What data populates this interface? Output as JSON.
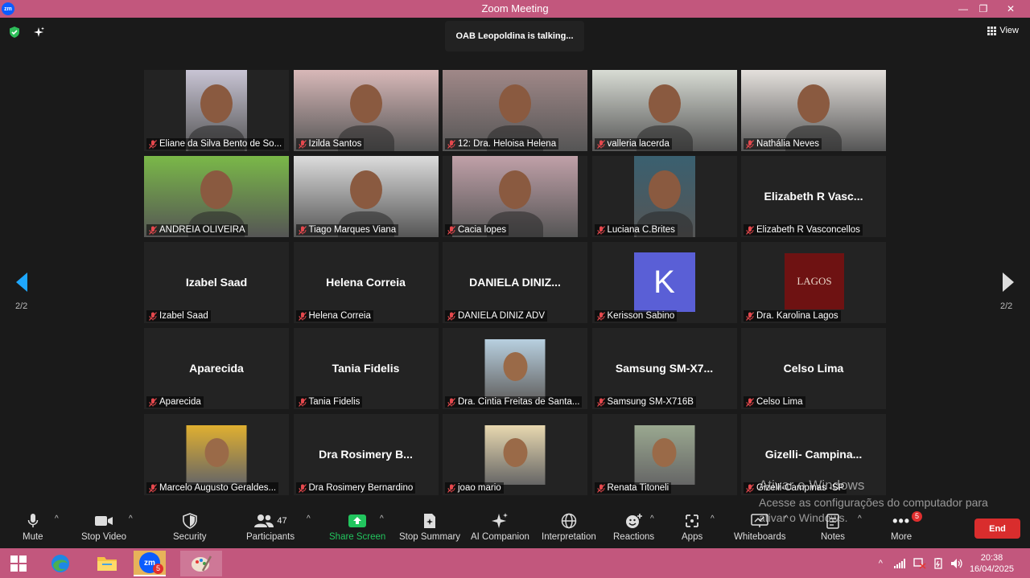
{
  "window": {
    "title": "Zoom Meeting",
    "minimize": "—",
    "maximize": "❐",
    "close": "✕"
  },
  "header": {
    "talking": "OAB Leopoldina is talking...",
    "view_label": "View"
  },
  "pager": {
    "left": "2/2",
    "right": "2/2"
  },
  "tiles": [
    {
      "name": "Eliane da Silva Bento de So...",
      "video": true,
      "bg": "#c8c4d4"
    },
    {
      "name": "Izilda Santos",
      "video": true,
      "bg": "#d8b8b8"
    },
    {
      "name": "12: Dra. Heloisa Helena",
      "video": true,
      "bg": "#a08888"
    },
    {
      "name": "valleria lacerda",
      "video": true,
      "bg": "#d8dcd4"
    },
    {
      "name": "Nathália Neves",
      "video": true,
      "bg": "#e4e0dc"
    },
    {
      "name": "ANDREIA OLIVEIRA",
      "video": true,
      "bg": "#7ab848"
    },
    {
      "name": "Tiago Marques Viana",
      "video": true,
      "bg": "#dcdcdc"
    },
    {
      "name": "Cacia lopes",
      "video": true,
      "bg": "#c0a0a8"
    },
    {
      "name": "Luciana C.Brites",
      "video": true,
      "bg": "#3a6070"
    },
    {
      "name": "Elizabeth R Vasconcellos",
      "big": "Elizabeth R Vasc...",
      "video": false
    },
    {
      "name": "Izabel Saad",
      "big": "Izabel Saad",
      "video": false
    },
    {
      "name": "Helena Correia",
      "big": "Helena Correia",
      "video": false
    },
    {
      "name": "DANIELA DINIZ ADV",
      "big": "DANIELA DINIZ...",
      "video": false
    },
    {
      "name": "Kerisson Sabino",
      "avatar": "K",
      "video": false
    },
    {
      "name": "Dra. Karolina Lagos",
      "logo": "LAGOS",
      "video": false
    },
    {
      "name": "Aparecida",
      "big": "Aparecida",
      "video": false
    },
    {
      "name": "Tania Fidelis",
      "big": "Tania Fidelis",
      "video": false
    },
    {
      "name": "Dra. Cintia Freitas de Santa...",
      "photo": true,
      "bg": "#b8d0e0",
      "video": false
    },
    {
      "name": "Samsung SM-X716B",
      "big": "Samsung SM-X7...",
      "video": false
    },
    {
      "name": "Celso Lima",
      "big": "Celso Lima",
      "video": false
    },
    {
      "name": "Marcelo Augusto Geraldes...",
      "photo": true,
      "bg": "#e0b030",
      "video": false
    },
    {
      "name": "Dra Rosimery Bernardino",
      "big": "Dra Rosimery B...",
      "video": false
    },
    {
      "name": "joao mario",
      "photo": true,
      "bg": "#e8d8b0",
      "video": false
    },
    {
      "name": "Renata Titoneli",
      "photo": true,
      "bg": "#9aa890",
      "video": false
    },
    {
      "name": "Gizelli-Campinas -SP",
      "big": "Gizelli-  Campina...",
      "video": false
    }
  ],
  "toolbar": {
    "mute": "Mute",
    "stop_video": "Stop Video",
    "security": "Security",
    "participants": "Participants",
    "participants_count": "47",
    "share_screen": "Share Screen",
    "stop_summary": "Stop Summary",
    "ai_companion": "AI Companion",
    "interpretation": "Interpretation",
    "reactions": "Reactions",
    "apps": "Apps",
    "whiteboards": "Whiteboards",
    "notes": "Notes",
    "more": "More",
    "more_badge": "5",
    "end": "End"
  },
  "watermark": {
    "title": "Ativar o Windows",
    "body": "Acesse as configurações do computador para ativar o Windows."
  },
  "taskbar": {
    "time": "20:38",
    "date": "16/04/2025",
    "zoom_badge": "5"
  },
  "colors": {
    "accent": "#c2577d",
    "end": "#d92d2d",
    "share": "#22c55e"
  }
}
